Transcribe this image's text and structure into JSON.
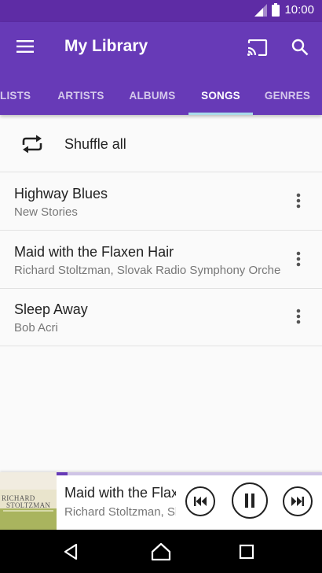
{
  "status_bar": {
    "time": "10:00"
  },
  "app_bar": {
    "title": "My Library",
    "tabs": [
      {
        "label": "LISTS"
      },
      {
        "label": "ARTISTS"
      },
      {
        "label": "ALBUMS"
      },
      {
        "label": "SONGS",
        "active": true
      },
      {
        "label": "GENRES"
      }
    ]
  },
  "shuffle": {
    "label": "Shuffle all"
  },
  "songs": [
    {
      "title": "Highway Blues",
      "artist": "New Stories"
    },
    {
      "title": "Maid with the Flaxen Hair",
      "artist": "Richard Stoltzman, Slovak Radio Symphony Orchestra"
    },
    {
      "title": "Sleep Away",
      "artist": "Bob Acri"
    }
  ],
  "mini_player": {
    "title": "Maid with the Flaxen Hair",
    "artist": "Richard Stoltzman, Slovak Radio Symphony Orchestra",
    "progress": 0.04,
    "album_art_text": [
      "RICHARD",
      "STOLTZMAN"
    ]
  },
  "colors": {
    "primary": "#673ab7",
    "primary_dark": "#5e2ca5",
    "tab_indicator": "#a9dbea"
  }
}
